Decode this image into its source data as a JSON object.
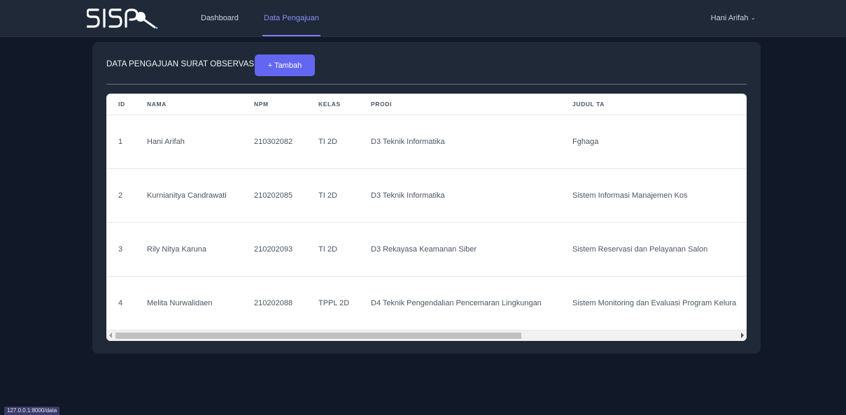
{
  "navbar": {
    "logo_text": "SISP",
    "links": [
      {
        "label": "Dashboard",
        "active": false
      },
      {
        "label": "Data Pengajuan",
        "active": true
      }
    ],
    "user_name": "Hani Arifah",
    "user_chevron": "⌄"
  },
  "card": {
    "title": "DATA PENGAJUAN SURAT OBSERVASI",
    "add_label": "+ Tambah"
  },
  "table": {
    "headers": {
      "id": "ID",
      "nama": "NAMA",
      "npm": "NPM",
      "kelas": "KELAS",
      "prodi": "PRODI",
      "judul": "JUDUL TA"
    },
    "rows": [
      {
        "id": "1",
        "nama": "Hani Arifah",
        "npm": "210302082",
        "kelas": "TI 2D",
        "prodi": "D3 Teknik Informatika",
        "judul": "Fghaga"
      },
      {
        "id": "2",
        "nama": "Kurnianitya Candrawati",
        "npm": "210202085",
        "kelas": "TI 2D",
        "prodi": "D3 Teknik Informatika",
        "judul": "Sistem Informasi Manajemen Kos"
      },
      {
        "id": "3",
        "nama": "Rily Nitya Karuna",
        "npm": "210202093",
        "kelas": "TI 2D",
        "prodi": "D3 Rekayasa Keamanan Siber",
        "judul": "Sistem Reservasi dan Pelayanan Salon"
      },
      {
        "id": "4",
        "nama": "Melita Nurwalidaen",
        "npm": "210202088",
        "kelas": "TPPL 2D",
        "prodi": "D4 Teknik Pengendalian Pencemaran Lingkungan",
        "judul": "Sistem Monitoring dan Evaluasi Program Kelura"
      }
    ]
  },
  "status_bar": {
    "url": "127.0.0.1:8000/data"
  },
  "colors": {
    "page_bg": "#111827",
    "nav_bg": "#1f2937",
    "card_bg": "#1f2937",
    "accent": "#6366f1",
    "active_link": "#8b8cf6"
  }
}
